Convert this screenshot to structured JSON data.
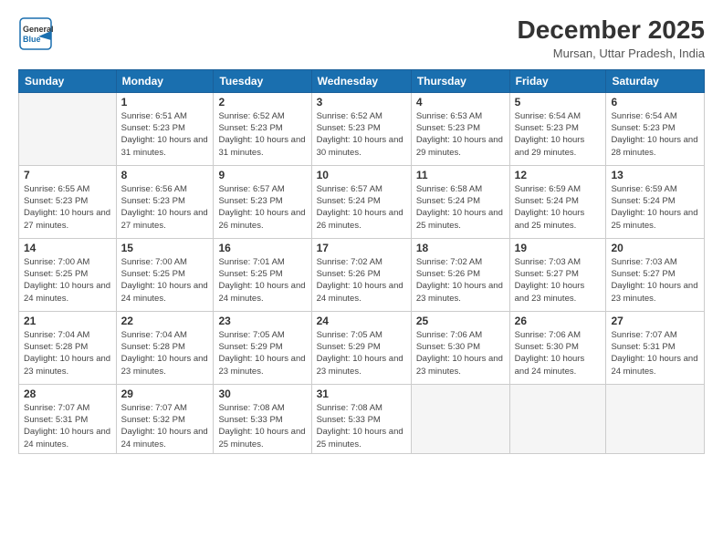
{
  "header": {
    "logo_general": "General",
    "logo_blue": "Blue",
    "month_title": "December 2025",
    "location": "Mursan, Uttar Pradesh, India"
  },
  "weekdays": [
    "Sunday",
    "Monday",
    "Tuesday",
    "Wednesday",
    "Thursday",
    "Friday",
    "Saturday"
  ],
  "weeks": [
    [
      {
        "day": "",
        "sunrise": "",
        "sunset": "",
        "daylight": ""
      },
      {
        "day": "1",
        "sunrise": "Sunrise: 6:51 AM",
        "sunset": "Sunset: 5:23 PM",
        "daylight": "Daylight: 10 hours and 31 minutes."
      },
      {
        "day": "2",
        "sunrise": "Sunrise: 6:52 AM",
        "sunset": "Sunset: 5:23 PM",
        "daylight": "Daylight: 10 hours and 31 minutes."
      },
      {
        "day": "3",
        "sunrise": "Sunrise: 6:52 AM",
        "sunset": "Sunset: 5:23 PM",
        "daylight": "Daylight: 10 hours and 30 minutes."
      },
      {
        "day": "4",
        "sunrise": "Sunrise: 6:53 AM",
        "sunset": "Sunset: 5:23 PM",
        "daylight": "Daylight: 10 hours and 29 minutes."
      },
      {
        "day": "5",
        "sunrise": "Sunrise: 6:54 AM",
        "sunset": "Sunset: 5:23 PM",
        "daylight": "Daylight: 10 hours and 29 minutes."
      },
      {
        "day": "6",
        "sunrise": "Sunrise: 6:54 AM",
        "sunset": "Sunset: 5:23 PM",
        "daylight": "Daylight: 10 hours and 28 minutes."
      }
    ],
    [
      {
        "day": "7",
        "sunrise": "Sunrise: 6:55 AM",
        "sunset": "Sunset: 5:23 PM",
        "daylight": "Daylight: 10 hours and 27 minutes."
      },
      {
        "day": "8",
        "sunrise": "Sunrise: 6:56 AM",
        "sunset": "Sunset: 5:23 PM",
        "daylight": "Daylight: 10 hours and 27 minutes."
      },
      {
        "day": "9",
        "sunrise": "Sunrise: 6:57 AM",
        "sunset": "Sunset: 5:23 PM",
        "daylight": "Daylight: 10 hours and 26 minutes."
      },
      {
        "day": "10",
        "sunrise": "Sunrise: 6:57 AM",
        "sunset": "Sunset: 5:24 PM",
        "daylight": "Daylight: 10 hours and 26 minutes."
      },
      {
        "day": "11",
        "sunrise": "Sunrise: 6:58 AM",
        "sunset": "Sunset: 5:24 PM",
        "daylight": "Daylight: 10 hours and 25 minutes."
      },
      {
        "day": "12",
        "sunrise": "Sunrise: 6:59 AM",
        "sunset": "Sunset: 5:24 PM",
        "daylight": "Daylight: 10 hours and 25 minutes."
      },
      {
        "day": "13",
        "sunrise": "Sunrise: 6:59 AM",
        "sunset": "Sunset: 5:24 PM",
        "daylight": "Daylight: 10 hours and 25 minutes."
      }
    ],
    [
      {
        "day": "14",
        "sunrise": "Sunrise: 7:00 AM",
        "sunset": "Sunset: 5:25 PM",
        "daylight": "Daylight: 10 hours and 24 minutes."
      },
      {
        "day": "15",
        "sunrise": "Sunrise: 7:00 AM",
        "sunset": "Sunset: 5:25 PM",
        "daylight": "Daylight: 10 hours and 24 minutes."
      },
      {
        "day": "16",
        "sunrise": "Sunrise: 7:01 AM",
        "sunset": "Sunset: 5:25 PM",
        "daylight": "Daylight: 10 hours and 24 minutes."
      },
      {
        "day": "17",
        "sunrise": "Sunrise: 7:02 AM",
        "sunset": "Sunset: 5:26 PM",
        "daylight": "Daylight: 10 hours and 24 minutes."
      },
      {
        "day": "18",
        "sunrise": "Sunrise: 7:02 AM",
        "sunset": "Sunset: 5:26 PM",
        "daylight": "Daylight: 10 hours and 23 minutes."
      },
      {
        "day": "19",
        "sunrise": "Sunrise: 7:03 AM",
        "sunset": "Sunset: 5:27 PM",
        "daylight": "Daylight: 10 hours and 23 minutes."
      },
      {
        "day": "20",
        "sunrise": "Sunrise: 7:03 AM",
        "sunset": "Sunset: 5:27 PM",
        "daylight": "Daylight: 10 hours and 23 minutes."
      }
    ],
    [
      {
        "day": "21",
        "sunrise": "Sunrise: 7:04 AM",
        "sunset": "Sunset: 5:28 PM",
        "daylight": "Daylight: 10 hours and 23 minutes."
      },
      {
        "day": "22",
        "sunrise": "Sunrise: 7:04 AM",
        "sunset": "Sunset: 5:28 PM",
        "daylight": "Daylight: 10 hours and 23 minutes."
      },
      {
        "day": "23",
        "sunrise": "Sunrise: 7:05 AM",
        "sunset": "Sunset: 5:29 PM",
        "daylight": "Daylight: 10 hours and 23 minutes."
      },
      {
        "day": "24",
        "sunrise": "Sunrise: 7:05 AM",
        "sunset": "Sunset: 5:29 PM",
        "daylight": "Daylight: 10 hours and 23 minutes."
      },
      {
        "day": "25",
        "sunrise": "Sunrise: 7:06 AM",
        "sunset": "Sunset: 5:30 PM",
        "daylight": "Daylight: 10 hours and 23 minutes."
      },
      {
        "day": "26",
        "sunrise": "Sunrise: 7:06 AM",
        "sunset": "Sunset: 5:30 PM",
        "daylight": "Daylight: 10 hours and 24 minutes."
      },
      {
        "day": "27",
        "sunrise": "Sunrise: 7:07 AM",
        "sunset": "Sunset: 5:31 PM",
        "daylight": "Daylight: 10 hours and 24 minutes."
      }
    ],
    [
      {
        "day": "28",
        "sunrise": "Sunrise: 7:07 AM",
        "sunset": "Sunset: 5:31 PM",
        "daylight": "Daylight: 10 hours and 24 minutes."
      },
      {
        "day": "29",
        "sunrise": "Sunrise: 7:07 AM",
        "sunset": "Sunset: 5:32 PM",
        "daylight": "Daylight: 10 hours and 24 minutes."
      },
      {
        "day": "30",
        "sunrise": "Sunrise: 7:08 AM",
        "sunset": "Sunset: 5:33 PM",
        "daylight": "Daylight: 10 hours and 25 minutes."
      },
      {
        "day": "31",
        "sunrise": "Sunrise: 7:08 AM",
        "sunset": "Sunset: 5:33 PM",
        "daylight": "Daylight: 10 hours and 25 minutes."
      },
      {
        "day": "",
        "sunrise": "",
        "sunset": "",
        "daylight": ""
      },
      {
        "day": "",
        "sunrise": "",
        "sunset": "",
        "daylight": ""
      },
      {
        "day": "",
        "sunrise": "",
        "sunset": "",
        "daylight": ""
      }
    ]
  ]
}
